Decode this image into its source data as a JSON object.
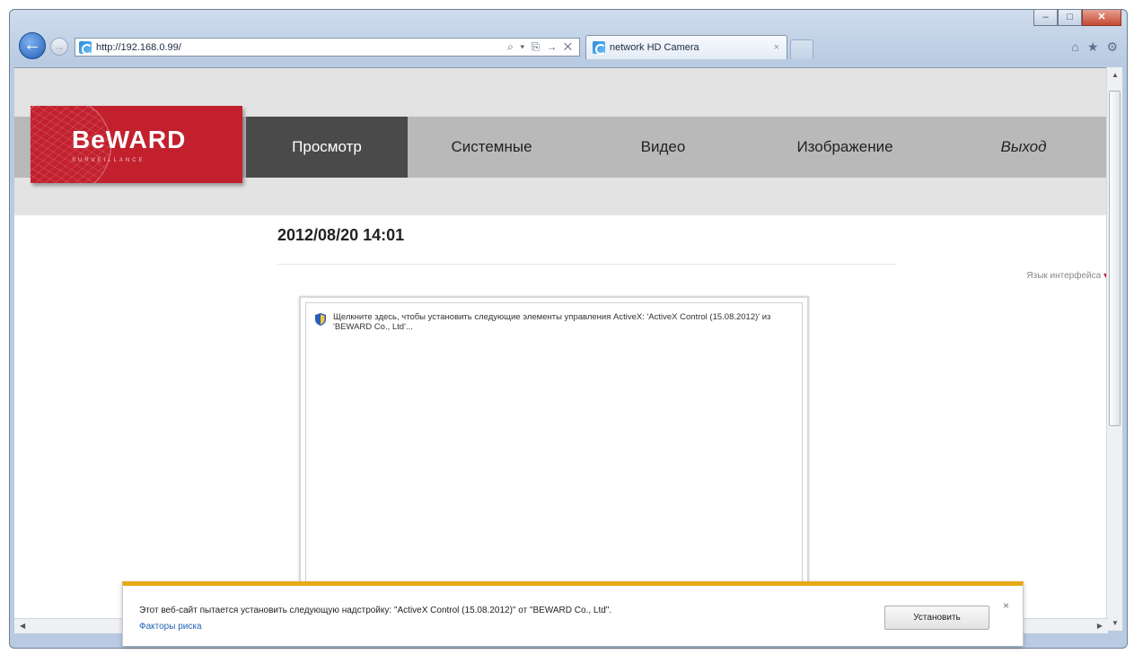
{
  "browser": {
    "address": "http://192.168.0.99/",
    "address_tools": "⌕ ▾ ⎘ → ✕",
    "tab_title": "network HD Camera",
    "tab_close": "×",
    "back_glyph": "←",
    "forward_glyph": "→",
    "caption": {
      "minimize": "–",
      "maximize": "□",
      "close": "✕"
    },
    "toolbar": {
      "home": "⌂",
      "favorites": "★",
      "tools": "⚙"
    }
  },
  "page": {
    "logo": {
      "text": "BeWARD",
      "subtitle": "SURVEILLANCE"
    },
    "nav": [
      {
        "label": "Просмотр"
      },
      {
        "label": "Системные"
      },
      {
        "label": "Видео"
      },
      {
        "label": "Изображение"
      },
      {
        "label": "Выход"
      }
    ],
    "datetime": "2012/08/20 14:01",
    "language_label": "Язык интерфейса",
    "language_arrow": "▾",
    "activex_message": "Щелкните здесь, чтобы установить следующие элементы управления ActiveX: 'ActiveX Control (15.08.2012)' из 'BEWARD Co., Ltd'..."
  },
  "notification": {
    "text": "Этот веб-сайт пытается установить следующую надстройку: \"ActiveX Control (15.08.2012)\" от \"BEWARD Co., Ltd\".",
    "link": "Факторы риска",
    "install_label": "Установить",
    "close_glyph": "×"
  },
  "colors": {
    "brand_red": "#c3202e",
    "active_tab": "#4a4a4a",
    "notification_accent": "#e7a913"
  }
}
